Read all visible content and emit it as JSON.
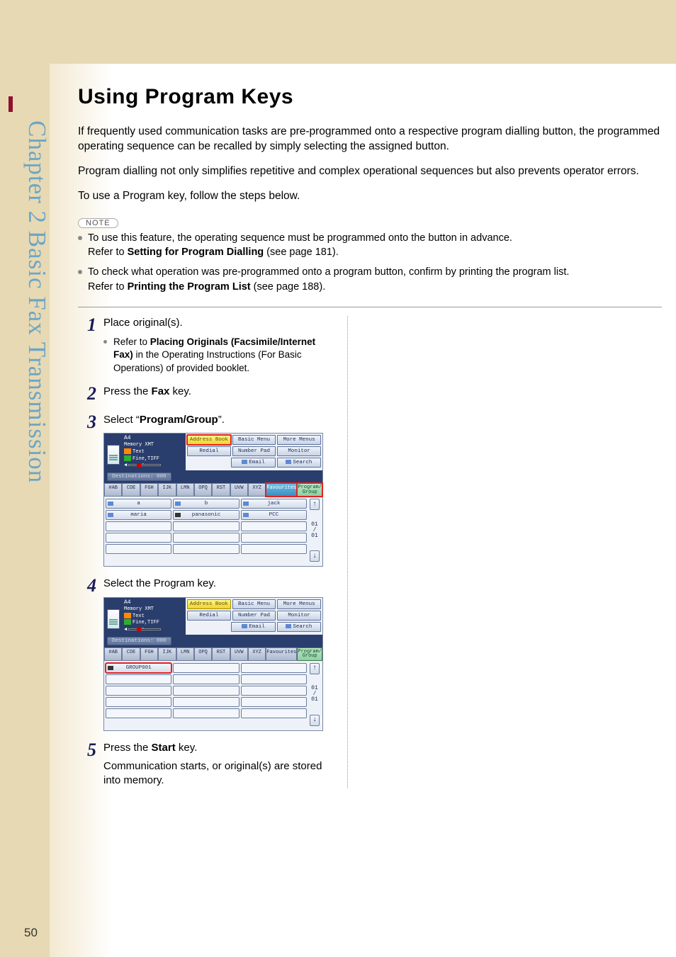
{
  "page_number": "50",
  "side_tab": "Chapter 2  Basic Fax Transmission",
  "title": "Using Program Keys",
  "intro": {
    "p1": "If frequently used communication tasks are pre-programmed onto a respective program dialling button, the programmed operating sequence can be recalled by simply selecting the assigned button.",
    "p2": "Program dialling not only simplifies repetitive and complex operational sequences but also prevents operator errors.",
    "p3": "To use a Program key, follow the steps below."
  },
  "note_label": "NOTE",
  "notes": {
    "n1a": "To use this feature, the operating sequence must be programmed onto the button in advance.",
    "n1b_prefix": "Refer to ",
    "n1b_bold": "Setting for Program Dialling",
    "n1b_suffix": " (see page 181).",
    "n2a": "To check what operation was pre-programmed onto a program button, confirm by printing the program list.",
    "n2b_prefix": "Refer to ",
    "n2b_bold": "Printing the Program List",
    "n2b_suffix": " (see page 188)."
  },
  "steps": {
    "s1": {
      "num": "1",
      "text": "Place original(s).",
      "sub_prefix": "Refer to ",
      "sub_bold": "Placing Originals (Facsimile/Internet Fax)",
      "sub_suffix": " in the Operating Instructions (For Basic Operations) of provided booklet."
    },
    "s2": {
      "num": "2",
      "pre": "Press the ",
      "bold": "Fax",
      "post": " key."
    },
    "s3": {
      "num": "3",
      "pre": "Select “",
      "bold": "Program/Group",
      "post": "”."
    },
    "s4": {
      "num": "4",
      "text": "Select the Program key."
    },
    "s5": {
      "num": "5",
      "pre": "Press the ",
      "bold": "Start",
      "post": " key.",
      "desc": "Communication starts, or original(s) are stored into memory."
    }
  },
  "panel": {
    "status": {
      "size": "A4",
      "mode": "Memory XMT",
      "quality": "Text",
      "file": "Fine,TIFF"
    },
    "dest": "Destinations: 000",
    "top_buttons": {
      "address_book": "Address Book",
      "basic_menu": "Basic Menu",
      "more_menus": "More Menus",
      "redial": "Redial",
      "number_pad": "Number Pad",
      "monitor": "Monitor",
      "email": "Email",
      "search": "Search"
    },
    "tabs": [
      "#AB",
      "CDE",
      "FGH",
      "IJK",
      "LMN",
      "OPQ",
      "RST",
      "UVW",
      "XYZ"
    ],
    "favourites": "Favourites",
    "program_group": "Program/\nGroup",
    "entries1": {
      "r1": [
        "a",
        "b",
        "jack"
      ],
      "r2": [
        "maria",
        "panasonic",
        "PCC"
      ]
    },
    "entries2": {
      "group": "GROUP001"
    },
    "page_indicator": {
      "cur": "01",
      "sep": "/",
      "tot": "01"
    }
  }
}
